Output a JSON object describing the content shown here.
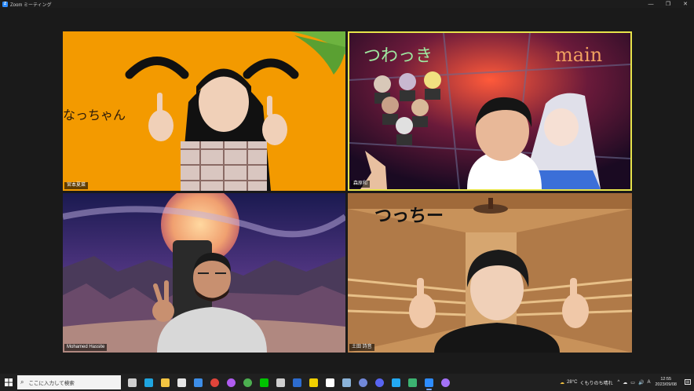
{
  "window": {
    "title": "Zoom ミーティング",
    "logo_letter": "Z",
    "controls": [
      "—",
      "❐",
      "✕"
    ]
  },
  "tiles": [
    {
      "name": "宮本夏菜",
      "overlay_text": "なっちゃん"
    },
    {
      "name": "森原和",
      "overlay_text": "つわっき",
      "overlay_text2": "main"
    },
    {
      "name": "Mohamed Hassite"
    },
    {
      "name": "土田 詩音",
      "overlay_text": "つっちー"
    }
  ],
  "taskbar": {
    "search_placeholder": "ここに入力して検索",
    "apps": [
      {
        "id": "task-view",
        "color": "#cfcfcf"
      },
      {
        "id": "edge",
        "color": "#1fa5e0"
      },
      {
        "id": "file-explorer",
        "color": "#f4c542"
      },
      {
        "id": "calendar",
        "color": "#e6e6e6"
      },
      {
        "id": "mail",
        "color": "#3d8ee8"
      },
      {
        "id": "chrome",
        "color": "#e0443a"
      },
      {
        "id": "app-purple",
        "color": "#b05cf0"
      },
      {
        "id": "chrome-2",
        "color": "#4caf50"
      },
      {
        "id": "line",
        "color": "#00c300"
      },
      {
        "id": "app-dark",
        "color": "#cfcfcf"
      },
      {
        "id": "app-blue",
        "color": "#2d6ccf"
      },
      {
        "id": "sticky",
        "color": "#f0d000"
      },
      {
        "id": "notion",
        "color": "#ffffff"
      },
      {
        "id": "app-img",
        "color": "#8bb3d9"
      },
      {
        "id": "discord-2",
        "color": "#7289da"
      },
      {
        "id": "discord",
        "color": "#5865f2"
      },
      {
        "id": "vscode",
        "color": "#23a9f2"
      },
      {
        "id": "app-green",
        "color": "#3cb371"
      },
      {
        "id": "zoom",
        "color": "#2d8cff"
      },
      {
        "id": "github",
        "color": "#a371f7"
      }
    ],
    "weather": {
      "temp": "28°C",
      "desc": "くもりのち晴れ"
    },
    "tray_icons": [
      "^",
      "☁",
      "▭",
      "🔊",
      "A"
    ],
    "clock": {
      "time": "12:55",
      "date": "2023/09/08"
    }
  }
}
